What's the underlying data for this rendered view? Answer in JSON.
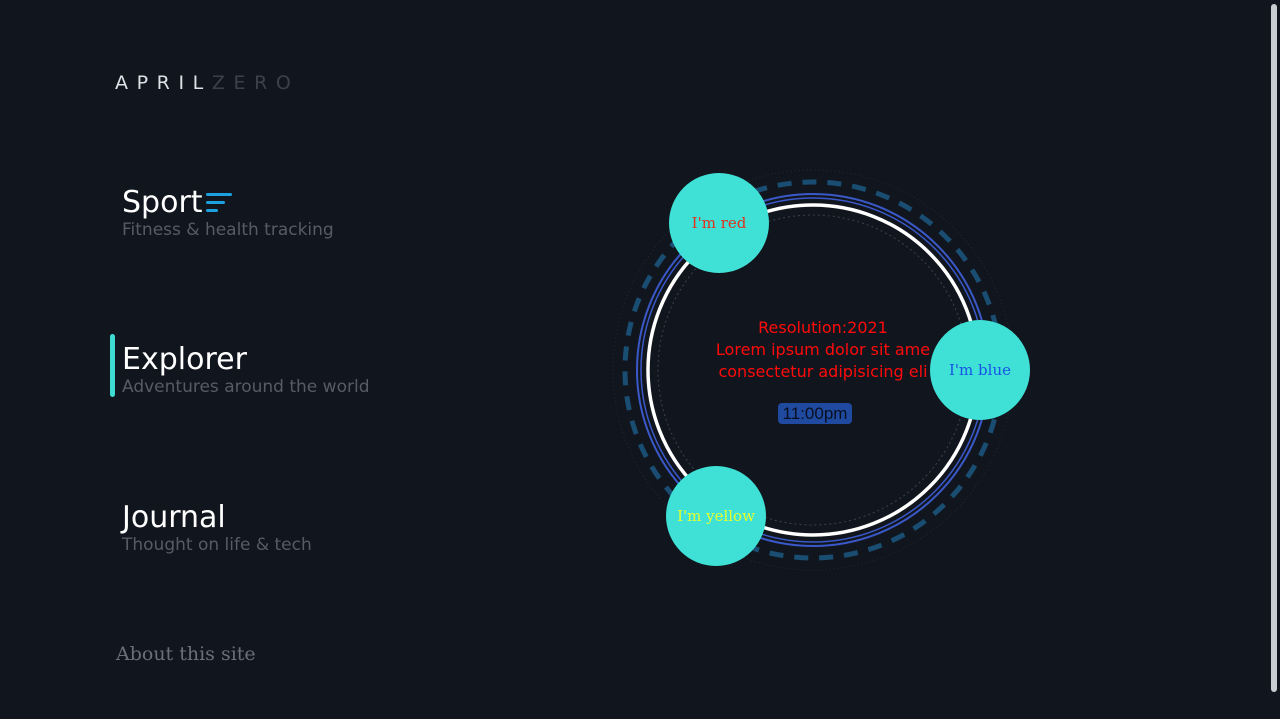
{
  "logo": {
    "bright": "APRIL",
    "dim": "ZERO"
  },
  "nav": {
    "sport": {
      "title": "Sport",
      "subtitle": "Fitness & health tracking"
    },
    "explorer": {
      "title": "Explorer",
      "subtitle": "Adventures around the world"
    },
    "journal": {
      "title": "Journal",
      "subtitle": "Thought on life & tech"
    }
  },
  "about_link": "About this site",
  "dial": {
    "resolution": "Resolution:2021",
    "line1": "Lorem ipsum dolor sit ame",
    "line2": "consectetur adipisicing eli",
    "time": "11:00pm",
    "bubbles": {
      "red": "I'm red",
      "blue": "I'm blue",
      "yellow": "I'm yellow"
    }
  },
  "colors": {
    "background": "#11161e",
    "accent_teal": "#3ddbd0",
    "sport_icon": "#1ba0e0",
    "dashed_ring": "#1a4d72",
    "blue_ring": "#3a58c8",
    "center_text": "#ff0a0a"
  },
  "icons": {
    "sport": "bars-lines-icon"
  }
}
